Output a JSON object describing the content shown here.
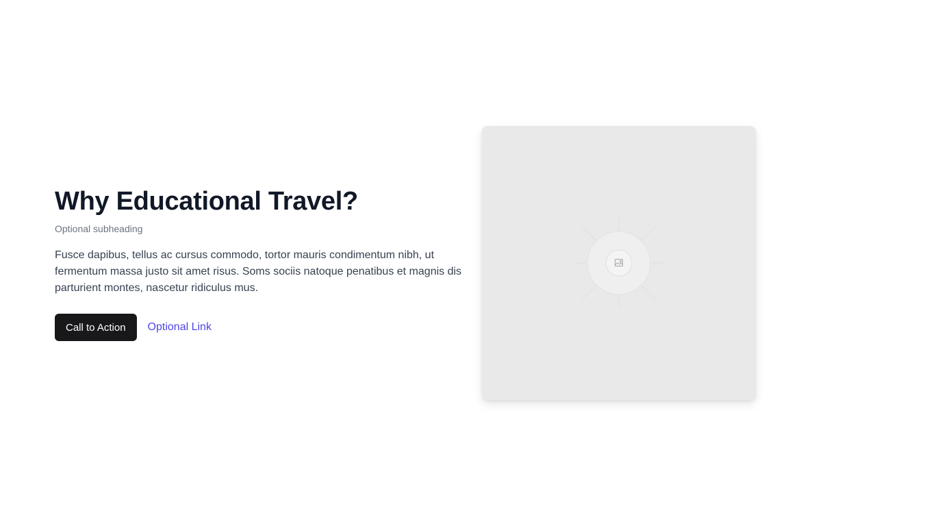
{
  "hero": {
    "title": "Why Educational Travel?",
    "subheading": "Optional subheading",
    "body": "Fusce dapibus, tellus ac cursus commodo, tortor mauris condimentum nibh, ut fermentum massa justo sit amet risus. Soms sociis natoque penatibus et magnis dis parturient montes, nascetur ridiculus mus.",
    "cta_label": "Call to Action",
    "link_label": "Optional Link"
  },
  "image_placeholder": {
    "icon": "image-icon"
  },
  "colors": {
    "cta_background": "#18181b",
    "link": "#4f46e5",
    "placeholder_background": "#e9e9e9"
  }
}
